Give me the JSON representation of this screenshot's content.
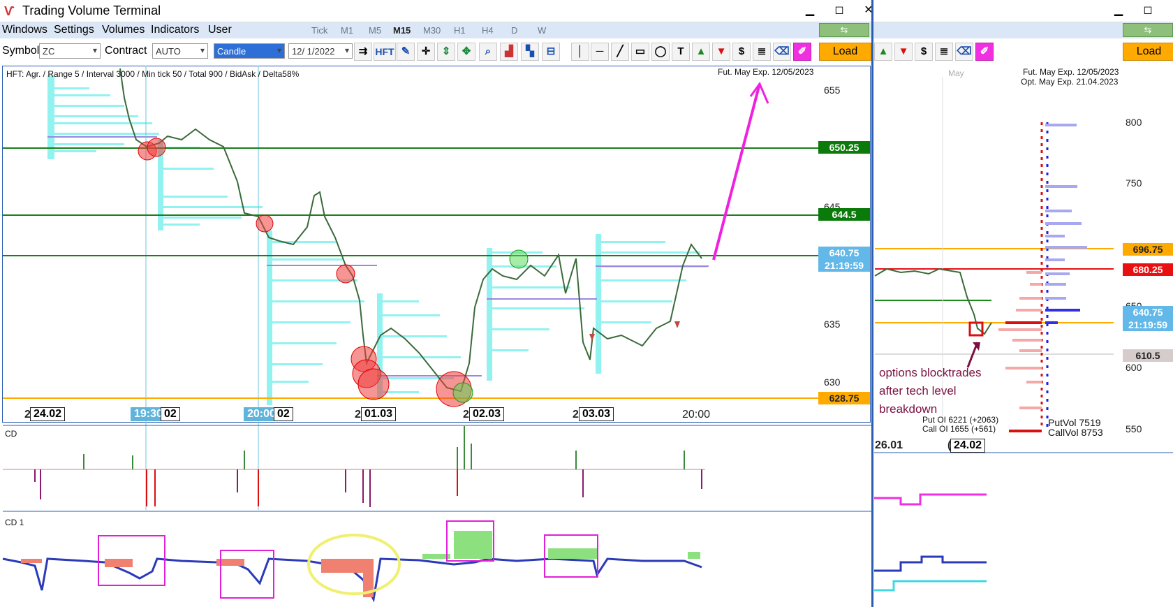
{
  "window": {
    "title": "Trading Volume Terminal",
    "min": "▁",
    "max": "◻",
    "close": "✕"
  },
  "menu": [
    "Windows",
    "Settings",
    "Volumes",
    "Indicators",
    "User"
  ],
  "timeframes": [
    "Tick",
    "M1",
    "M5",
    "M15",
    "M30",
    "H1",
    "H4",
    "D",
    "W"
  ],
  "active_timeframe": "M15",
  "toolbar": {
    "symbol_label": "Symbol",
    "symbol_value": "ZC",
    "contract_label": "Contract",
    "contract_value": "AUTO",
    "chart_type": "Candle",
    "date_value": "12/ 1/2022",
    "hft_label": "HFT",
    "load_label": "Load",
    "dollar": "$",
    "text_tool": "T"
  },
  "main_chart": {
    "header": "HFT: Agr. / Range 5 / Interval 3000 / Min tick 50 / Total 900 / BidAsk / Delta58%",
    "expiry": "Fut. May Exp. 12/05/2023",
    "price_ticks": [
      "655",
      "645",
      "635",
      "630"
    ],
    "levels": [
      {
        "label": "650.25",
        "color": "#0a7a0a"
      },
      {
        "label": "644.5",
        "color": "#0a7a0a"
      },
      {
        "label": "640.75",
        "color": "#62b8e8"
      },
      {
        "label": "21:19:59",
        "color": "#62b8e8"
      },
      {
        "label": "628.75",
        "color": "#ffaa00"
      }
    ],
    "time_labels": {
      "l1": "2",
      "d1": "24.02",
      "t1": "19:30",
      "t1b": "02",
      "t2": "20:00",
      "t2b": "02",
      "l3": "2",
      "d3": "01.03",
      "l4": "2",
      "d4": "02.03",
      "l5": "2",
      "d5": "03.03",
      "t6": "20:00"
    }
  },
  "cd_panel": {
    "label": "CD"
  },
  "cd1_panel": {
    "label": "CD 1"
  },
  "options_chart": {
    "month": "May",
    "fut_exp": "Fut. May Exp. 12/05/2023",
    "opt_exp": "Opt. May Exp. 21.04.2023",
    "price_ticks": [
      "800",
      "750",
      "650",
      "600",
      "550"
    ],
    "levels": [
      {
        "label": "696.75",
        "color": "#ffaa00"
      },
      {
        "label": "680.25",
        "color": "#e81010"
      },
      {
        "label": "640.75",
        "color": "#62b8e8"
      },
      {
        "label": "21:19:59",
        "color": "#62b8e8"
      },
      {
        "label": "610.5",
        "color": "#d6cccc"
      }
    ],
    "annotation": [
      "options blocktrades",
      "after tech level",
      "breakdown"
    ],
    "put_oi": "Put  OI  6221 (+2063)",
    "call_oi": "Call  OI  1655 (+561)",
    "put_vol": "PutVol  7519",
    "call_vol": "CallVol  8753",
    "dates": [
      "26.01",
      "24.02"
    ],
    "date_prefix": "("
  }
}
